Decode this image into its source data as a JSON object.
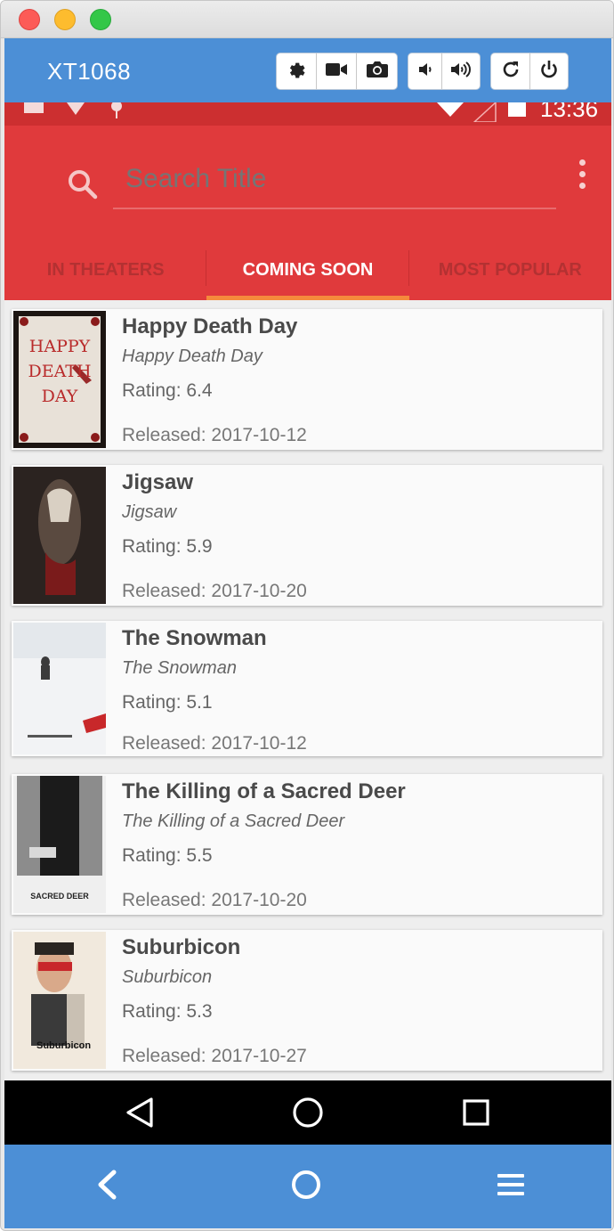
{
  "window": {
    "device_name": "XT1068"
  },
  "toolbar": {
    "icons": [
      "gear-icon",
      "video-camera-icon",
      "camera-icon",
      "volume-down-icon",
      "volume-up-icon",
      "rotate-icon",
      "power-icon"
    ]
  },
  "status_bar": {
    "time": "13:36"
  },
  "search": {
    "placeholder": "Search Title"
  },
  "tabs": [
    {
      "label": "IN THEATERS",
      "active": false
    },
    {
      "label": "COMING SOON",
      "active": true
    },
    {
      "label": "MOST POPULAR",
      "active": false
    }
  ],
  "movies": [
    {
      "title": "Happy Death Day",
      "original_title": "Happy Death Day",
      "rating": "Rating: 6.4",
      "released": "Released: 2017-10-12",
      "poster_text": "HAPPY DEATH DAY"
    },
    {
      "title": "Jigsaw",
      "original_title": "Jigsaw",
      "rating": "Rating: 5.9",
      "released": "Released: 2017-10-20"
    },
    {
      "title": "The Snowman",
      "original_title": "The Snowman",
      "rating": "Rating: 5.1",
      "released": "Released: 2017-10-12"
    },
    {
      "title": "The Killing of a Sacred Deer",
      "original_title": "The Killing of a Sacred Deer",
      "rating": "Rating: 5.5",
      "released": "Released: 2017-10-20",
      "poster_text": "SACRED DEER"
    },
    {
      "title": "Suburbicon",
      "original_title": "Suburbicon",
      "rating": "Rating: 5.3",
      "released": "Released: 2017-10-27",
      "poster_text": "Suburbicon"
    }
  ],
  "nav": {
    "icons": [
      "back-triangle-icon",
      "home-circle-icon",
      "recents-square-icon"
    ]
  },
  "bottom_controls": {
    "icons": [
      "chevron-left-icon",
      "circle-icon",
      "menu-icon"
    ]
  }
}
